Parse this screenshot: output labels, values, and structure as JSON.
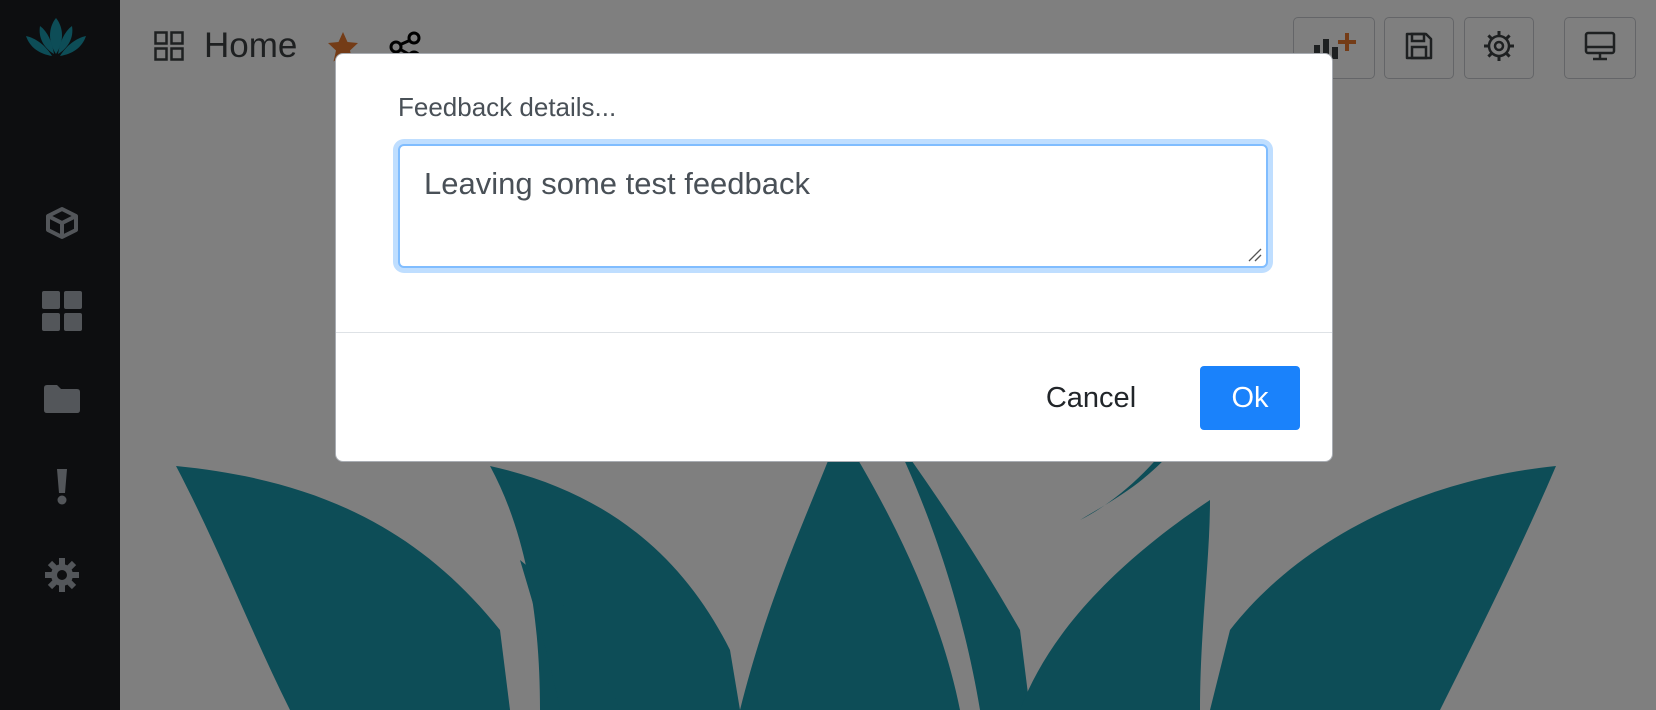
{
  "header": {
    "title": "Home"
  },
  "icons": {
    "logo": "lotus-logo-icon",
    "sidebar": [
      "cube-icon",
      "dashboard-icon",
      "folder-icon",
      "alert-icon",
      "gear-icon"
    ],
    "header": [
      "grid-icon",
      "star-icon",
      "share-icon"
    ],
    "toolbar": [
      "add-chart-icon",
      "save-icon",
      "settings-icon",
      "monitor-icon"
    ]
  },
  "colors": {
    "sidebar_bg": "#1a1d21",
    "brand_teal": "#1a9aaf",
    "star": "#e8782e",
    "primary": "#1a82fb"
  },
  "modal": {
    "label": "Feedback details...",
    "textarea_value": "Leaving some test feedback",
    "cancel_label": "Cancel",
    "ok_label": "Ok"
  }
}
